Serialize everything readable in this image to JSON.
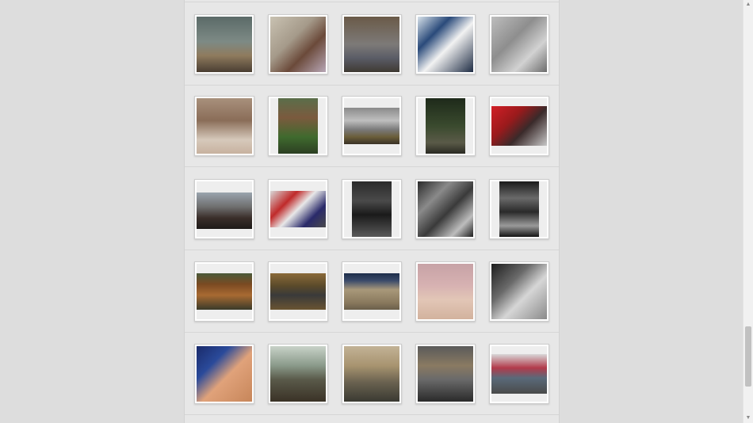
{
  "gallery": {
    "rows": [
      [
        {
          "name": "thumb-harbor-birds",
          "bg": "linear-gradient(180deg,#5b6a68 0%,#7d8a85 45%,#8f7b5e 70%,#4a3e32 100%)"
        },
        {
          "name": "thumb-sparrows",
          "bg": "linear-gradient(135deg,#c9c2b2 0%,#a59a8a 40%,#6b4a3a 65%,#b8a7b6 100%)"
        },
        {
          "name": "thumb-pigeons",
          "bg": "linear-gradient(180deg,#6a5a48 0%,#7d7a78 50%,#5a5c66 75%,#3f3a33 100%)"
        },
        {
          "name": "thumb-blue-cat",
          "bg": "linear-gradient(135deg,#d8e2ea 0%,#2a4a7a 30%,#f2f2f2 55%,#1e2c44 100%)"
        },
        {
          "name": "thumb-aerial-field",
          "bg": "linear-gradient(135deg,#bdbdbd 0%,#8e8e8e 40%,#d2d2d2 70%,#6c6c6c 100%)"
        }
      ],
      [
        {
          "name": "thumb-kitten",
          "bg": "linear-gradient(180deg,#a8907c 0%,#8a6d58 40%,#d6c9bb 75%,#c7b19f 100%)"
        },
        {
          "name": "thumb-wooden-house",
          "bg": "linear-gradient(180deg,#5a6e4a 0%,#7b5a3e 35%,#3f6a2e 70%,#2c3f22 100%)"
        },
        {
          "name": "thumb-snow-hill-tractor",
          "bg": "linear-gradient(180deg,#8a8a8a 0%,#bfbfbf 35%,#7a7a7a 60%,#6b5e3a 80%,#3a3226 100%)"
        },
        {
          "name": "thumb-forest-path",
          "bg": "linear-gradient(180deg,#1e2a1a 0%,#3a4a2e 50%,#5a5a48 80%,#2a2a22 100%)"
        },
        {
          "name": "thumb-red-flags-crowd",
          "bg": "linear-gradient(135deg,#d21f26 0%,#9a1a1c 35%,#3a2a2a 60%,#c8c8c8 100%)"
        }
      ],
      [
        {
          "name": "thumb-protest-crowd",
          "bg": "linear-gradient(180deg,#9aa4ae 0%,#6e6e6e 40%,#3a2e2a 70%,#1e1a18 100%)"
        },
        {
          "name": "thumb-flag-march",
          "bg": "linear-gradient(135deg,#d8d8d8 0%,#c02a2a 30%,#e8e8e8 50%,#2a2a6a 75%,#4a4a4a 100%)"
        },
        {
          "name": "thumb-dark-window",
          "bg": "linear-gradient(180deg,#2a2a2a 0%,#4a4a4a 35%,#1a1a1a 60%,#5a5a5a 100%)"
        },
        {
          "name": "thumb-brick-wall",
          "bg": "linear-gradient(135deg,#2a2a2a 0%,#8a8a8a 30%,#3a3a3a 55%,#bdbdbd 80%,#1e1e1e 100%)"
        },
        {
          "name": "thumb-arched-corridor",
          "bg": "linear-gradient(180deg,#1a1a1a 0%,#6a6a6a 30%,#2a2a2a 55%,#9a9a9a 80%,#141414 100%)"
        }
      ],
      [
        {
          "name": "thumb-wooden-door",
          "bg": "linear-gradient(180deg,#4a5a3a 0%,#7a4a22 30%,#a86a32 60%,#3a3a2a 100%)"
        },
        {
          "name": "thumb-arched-window",
          "bg": "linear-gradient(180deg,#8a6a3a 0%,#5a4a2a 35%,#3a3a3a 60%,#6a5432 100%)"
        },
        {
          "name": "thumb-stone-relief",
          "bg": "linear-gradient(180deg,#1e2e4a 0%,#3a4a6a 20%,#a8987a 45%,#8a7a5e 80%,#6a5e4a 100%)"
        },
        {
          "name": "thumb-baby-pink-hat",
          "bg": "linear-gradient(180deg,#c7a2a6 0%,#d7b2b2 40%,#e2c6b6 65%,#d2b29e 100%)"
        },
        {
          "name": "thumb-holding-hands",
          "bg": "linear-gradient(135deg,#1e1e1e 0%,#6a6a6a 35%,#d6d6d6 60%,#8a8a8a 100%)"
        }
      ],
      [
        {
          "name": "thumb-baby-feet",
          "bg": "linear-gradient(135deg,#1a2a6a 0%,#2a4a9a 30%,#e0a27a 55%,#c7865a 100%)"
        },
        {
          "name": "thumb-terrace-view",
          "bg": "linear-gradient(180deg,#c8d2c8 0%,#8a9a8a 35%,#5a5a4a 60%,#3a3226 100%)"
        },
        {
          "name": "thumb-city-skyline",
          "bg": "linear-gradient(180deg,#c2b296 0%,#a89470 35%,#6a6250 65%,#3a3a32 100%)"
        },
        {
          "name": "thumb-seagull-station",
          "bg": "linear-gradient(180deg,#5a5a5a 0%,#8a7a62 35%,#6a6a6a 60%,#2a2a2a 100%)"
        },
        {
          "name": "thumb-graffiti-street",
          "bg": "linear-gradient(180deg,#d8d8d8 0%,#b23a4a 35%,#5a6a7a 60%,#4a4a4a 100%)"
        }
      ]
    ]
  },
  "colors": {
    "page_background": "#dddddd",
    "panel_background": "#e7e7e7",
    "thumb_frame": "#ffffff"
  }
}
